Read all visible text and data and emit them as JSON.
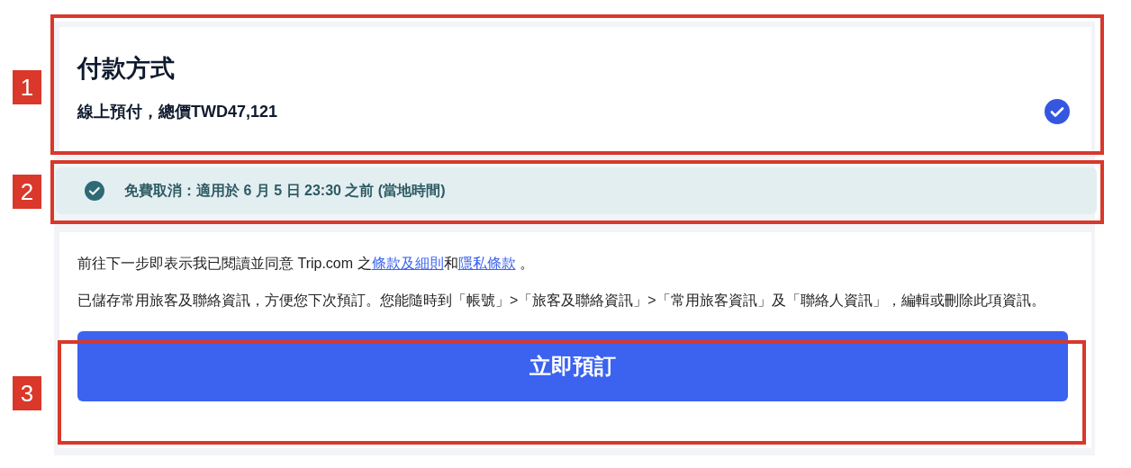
{
  "payment": {
    "title": "付款方式",
    "option": "線上預付，總價TWD47,121",
    "selected": true
  },
  "cancellation": {
    "text": "免費取消：適用於 6 月 5 日 23:30 之前 (當地時間)"
  },
  "agreement": {
    "prefix": "前往下一步即表示我已閱讀並同意 Trip.com 之",
    "link_1": "條款及細則",
    "middle": "和",
    "link_2": "隱私條款",
    "suffix": " 。"
  },
  "notice": "已儲存常用旅客及聯絡資訊，方便您下次預訂。您能隨時到「帳號」>「旅客及聯絡資訊」>「常用旅客資訊」及「聯絡人資訊」，編輯或刪除此項資訊。",
  "book_button": "立即預訂",
  "annotations": [
    {
      "label": "1"
    },
    {
      "label": "2"
    },
    {
      "label": "3"
    }
  ]
}
